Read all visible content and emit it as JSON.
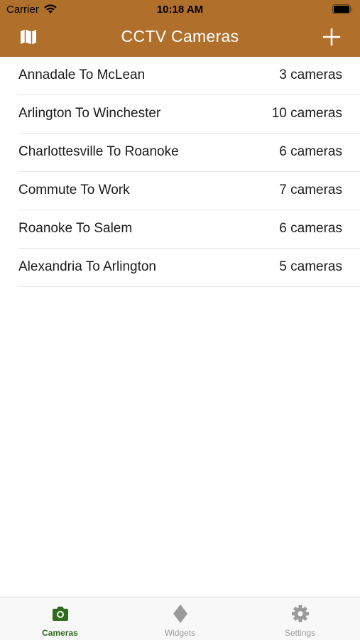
{
  "status_bar": {
    "carrier": "Carrier",
    "time": "10:18 AM"
  },
  "nav": {
    "title": "CCTV Cameras",
    "left_icon": "map-icon",
    "right_icon": "plus-icon"
  },
  "routes": [
    {
      "name": "Annadale To McLean",
      "count": "3 cameras"
    },
    {
      "name": "Arlington To Winchester",
      "count": "10 cameras"
    },
    {
      "name": "Charlottesville To Roanoke",
      "count": "6 cameras"
    },
    {
      "name": "Commute To Work",
      "count": "7 cameras"
    },
    {
      "name": "Roanoke To Salem",
      "count": "6 cameras"
    },
    {
      "name": "Alexandria To Arlington",
      "count": "5 cameras"
    }
  ],
  "tabs": [
    {
      "label": "Cameras",
      "icon": "camera-icon",
      "active": true
    },
    {
      "label": "Widgets",
      "icon": "diamond-icon",
      "active": false
    },
    {
      "label": "Settings",
      "icon": "gear-icon",
      "active": false
    }
  ],
  "colors": {
    "header": "#b0702c",
    "tab_active": "#2f6b1d",
    "tab_inactive": "#9a9a9a"
  }
}
